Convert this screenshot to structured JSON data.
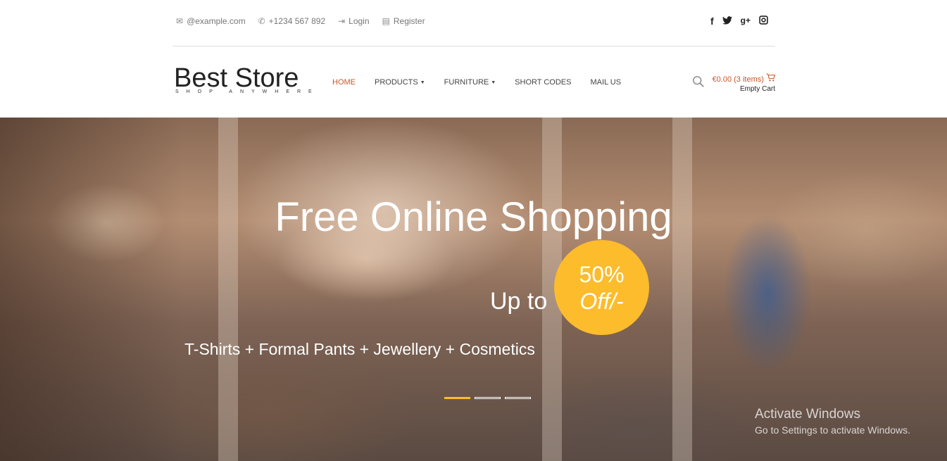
{
  "topbar": {
    "email": "@example.com",
    "phone": "+1234 567 892",
    "login": "Login",
    "register": "Register",
    "social": [
      "facebook-icon",
      "twitter-icon",
      "google-plus-icon",
      "instagram-icon"
    ]
  },
  "logo": {
    "name": "Best Store",
    "tagline": "SHOP ANYWHERE"
  },
  "nav": {
    "items": [
      {
        "label": "HOME",
        "active": true
      },
      {
        "label": "PRODUCTS",
        "dropdown": true
      },
      {
        "label": "FURNITURE",
        "dropdown": true
      },
      {
        "label": "SHORT CODES"
      },
      {
        "label": "MAIL US"
      }
    ]
  },
  "cart": {
    "total": "€0.00 (3 items)",
    "empty_label": "Empty Cart"
  },
  "hero": {
    "title": "Free Online Shopping",
    "upto": "Up to",
    "badge_pct": "50%",
    "badge_off": "Off/-",
    "subtitle": "T-Shirts + Formal Pants + Jewellery + Cosmetics",
    "slides": 3,
    "active_slide": 1
  },
  "watermark": {
    "heading": "Activate Windows",
    "text": "Go to Settings to activate Windows."
  },
  "colors": {
    "accent": "#c5572a",
    "badge": "#fcbc2c"
  }
}
